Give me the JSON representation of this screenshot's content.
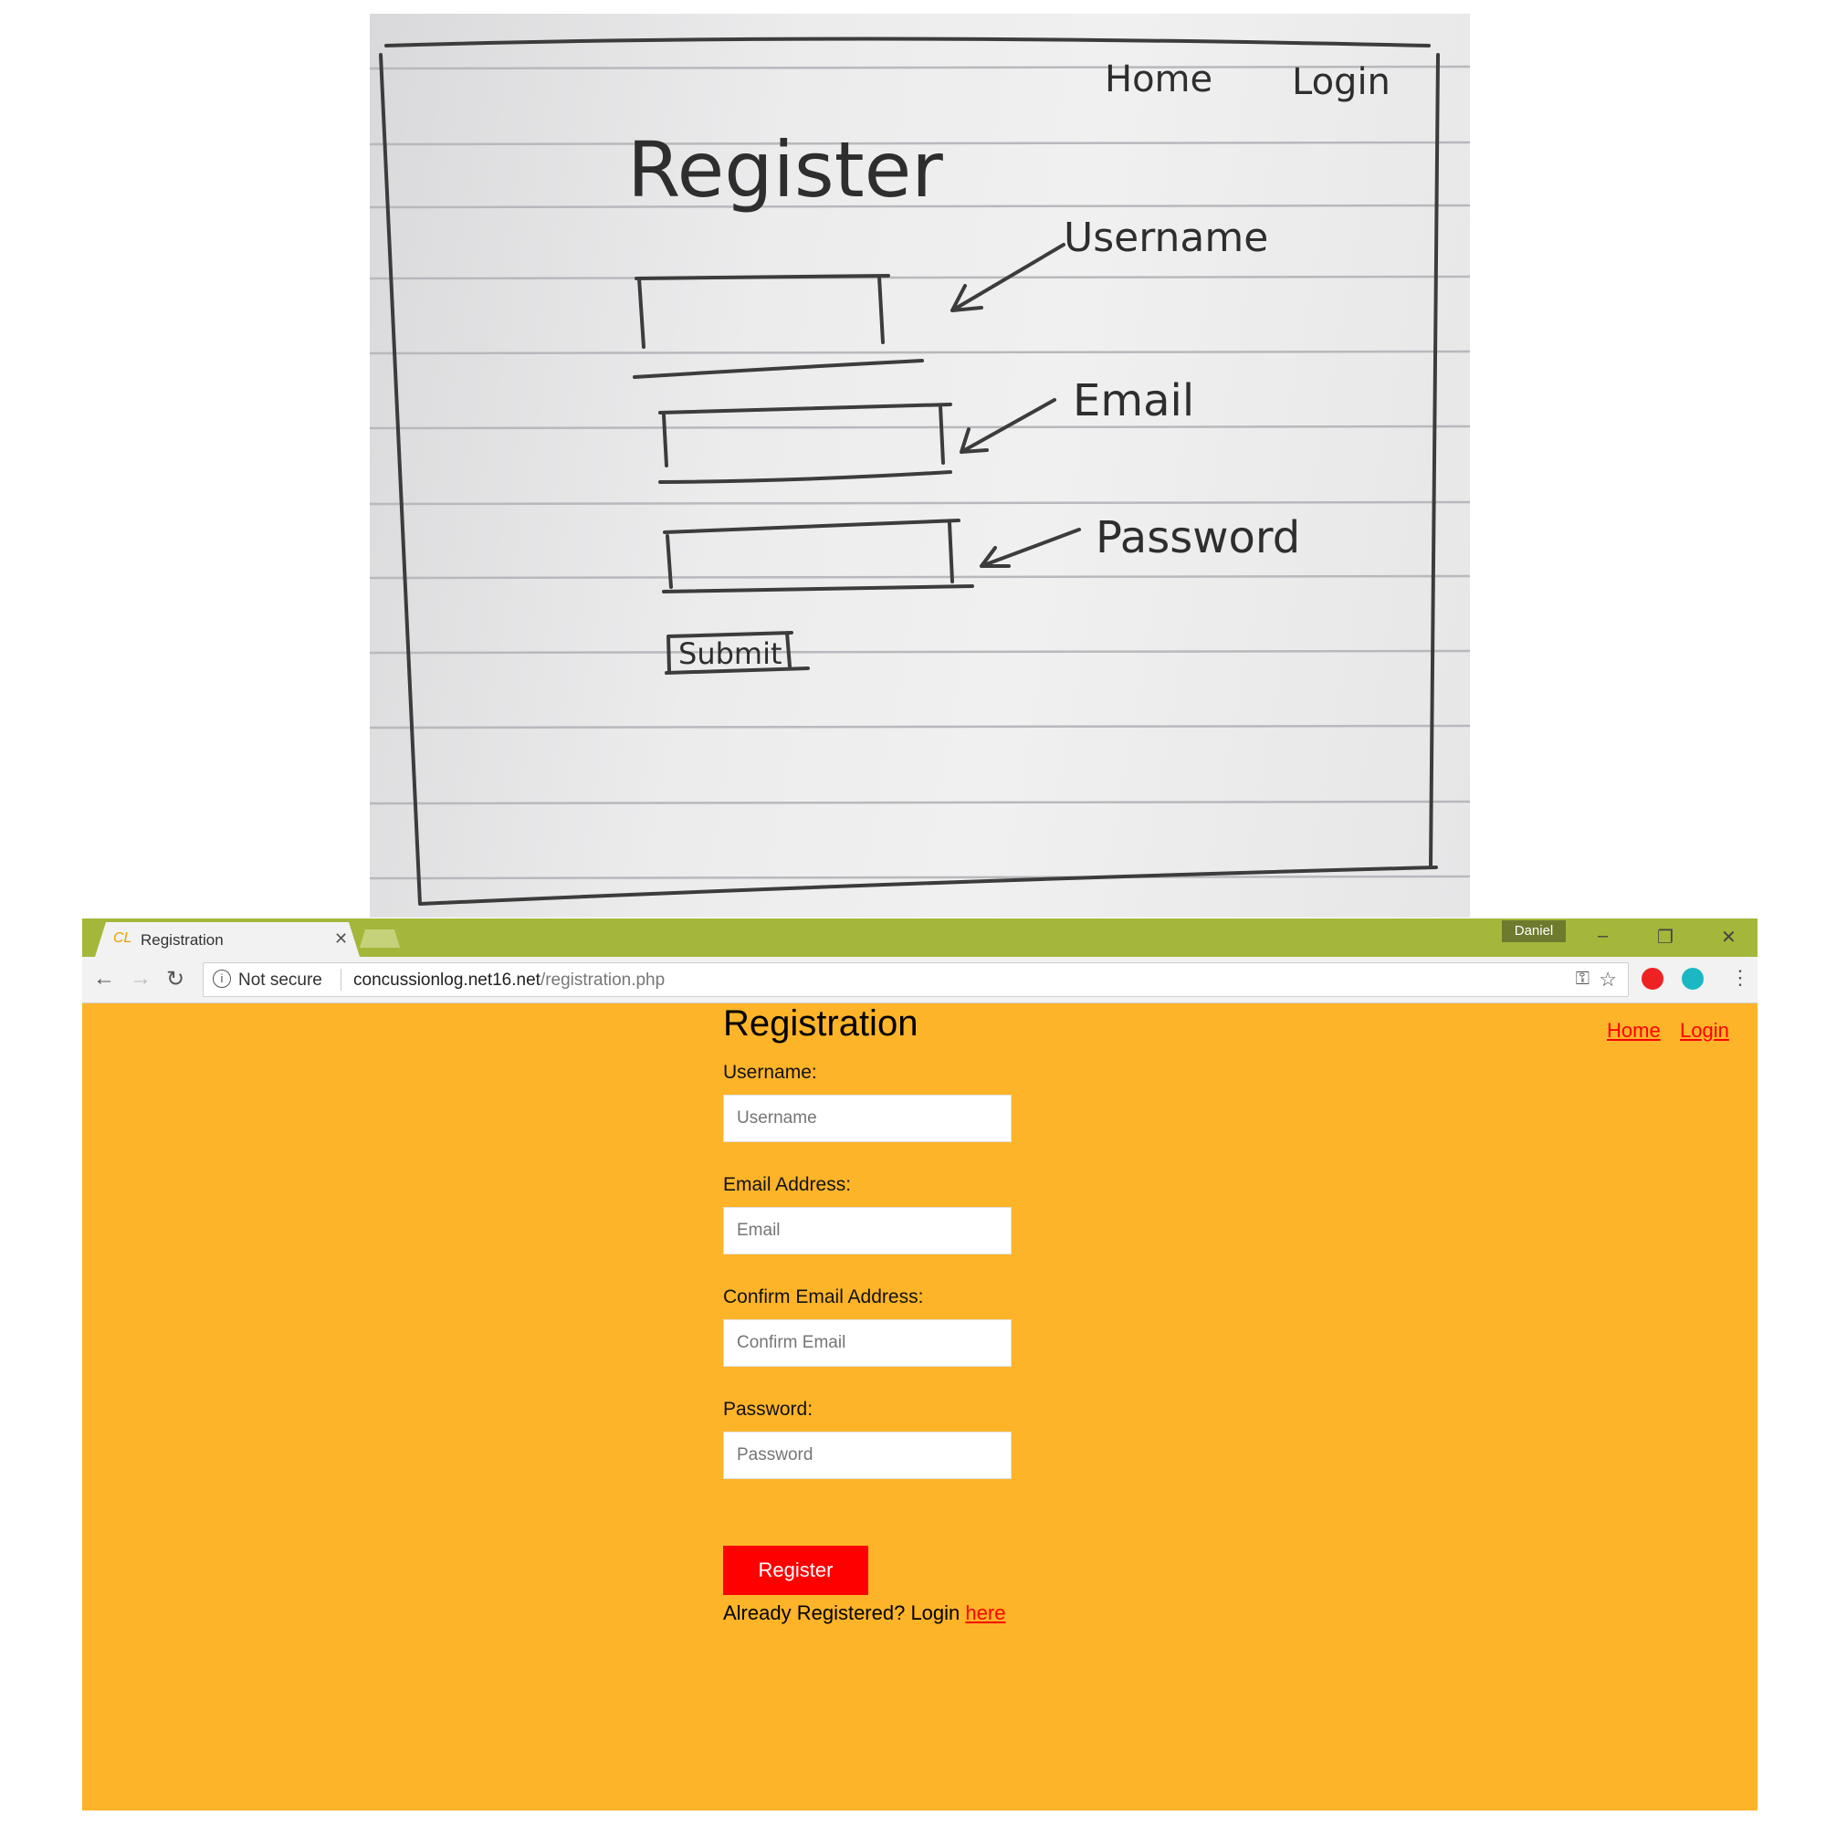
{
  "sketch": {
    "title": "Register",
    "nav": [
      "Home",
      "Login"
    ],
    "labels": [
      "Username",
      "Email",
      "Password"
    ],
    "submit": "Submit"
  },
  "browser": {
    "tab_title": "Registration",
    "favicon_text": "CL",
    "profile_name": "Daniel",
    "url_security": "Not secure",
    "url_host": "concussionlog.net16.net",
    "url_path": "/registration.php",
    "tabbar_color": "#a4b73b"
  },
  "page": {
    "background": "#fdb429",
    "title": "Registration",
    "nav": {
      "home": "Home",
      "login": "Login"
    },
    "fields": [
      {
        "label": "Username:",
        "placeholder": "Username"
      },
      {
        "label": "Email Address:",
        "placeholder": "Email"
      },
      {
        "label": "Confirm Email Address:",
        "placeholder": "Confirm Email"
      },
      {
        "label": "Password:",
        "placeholder": "Password"
      }
    ],
    "register_label": "Register",
    "already_text": "Already Registered? Login",
    "here_link": "here",
    "accent": "#ff0000"
  }
}
